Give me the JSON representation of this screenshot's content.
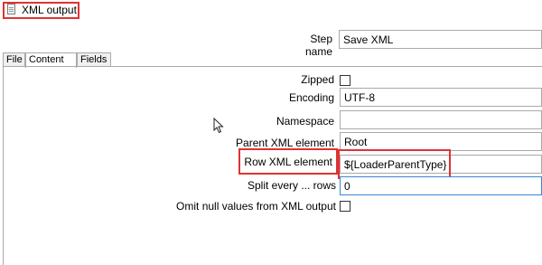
{
  "window": {
    "title": "XML output"
  },
  "step": {
    "label": "Step name",
    "value": "Save XML"
  },
  "tabs": [
    {
      "label": "File"
    },
    {
      "label": "Content"
    },
    {
      "label": "Fields"
    }
  ],
  "content": {
    "zipped": {
      "label": "Zipped",
      "checked": false
    },
    "encoding": {
      "label": "Encoding",
      "value": "UTF-8"
    },
    "namespace": {
      "label": "Namespace",
      "value": ""
    },
    "parent_xml_element": {
      "label": "Parent XML element",
      "value": "Root"
    },
    "row_xml_element": {
      "label": "Row XML element",
      "value": "${LoaderParentType}"
    },
    "split_every_rows": {
      "label": "Split every ... rows",
      "value": "0"
    },
    "omit_null": {
      "label": "Omit null values from XML output",
      "checked": false
    }
  },
  "colors": {
    "highlight": "#e03232",
    "focus_border": "#3a86d4"
  }
}
